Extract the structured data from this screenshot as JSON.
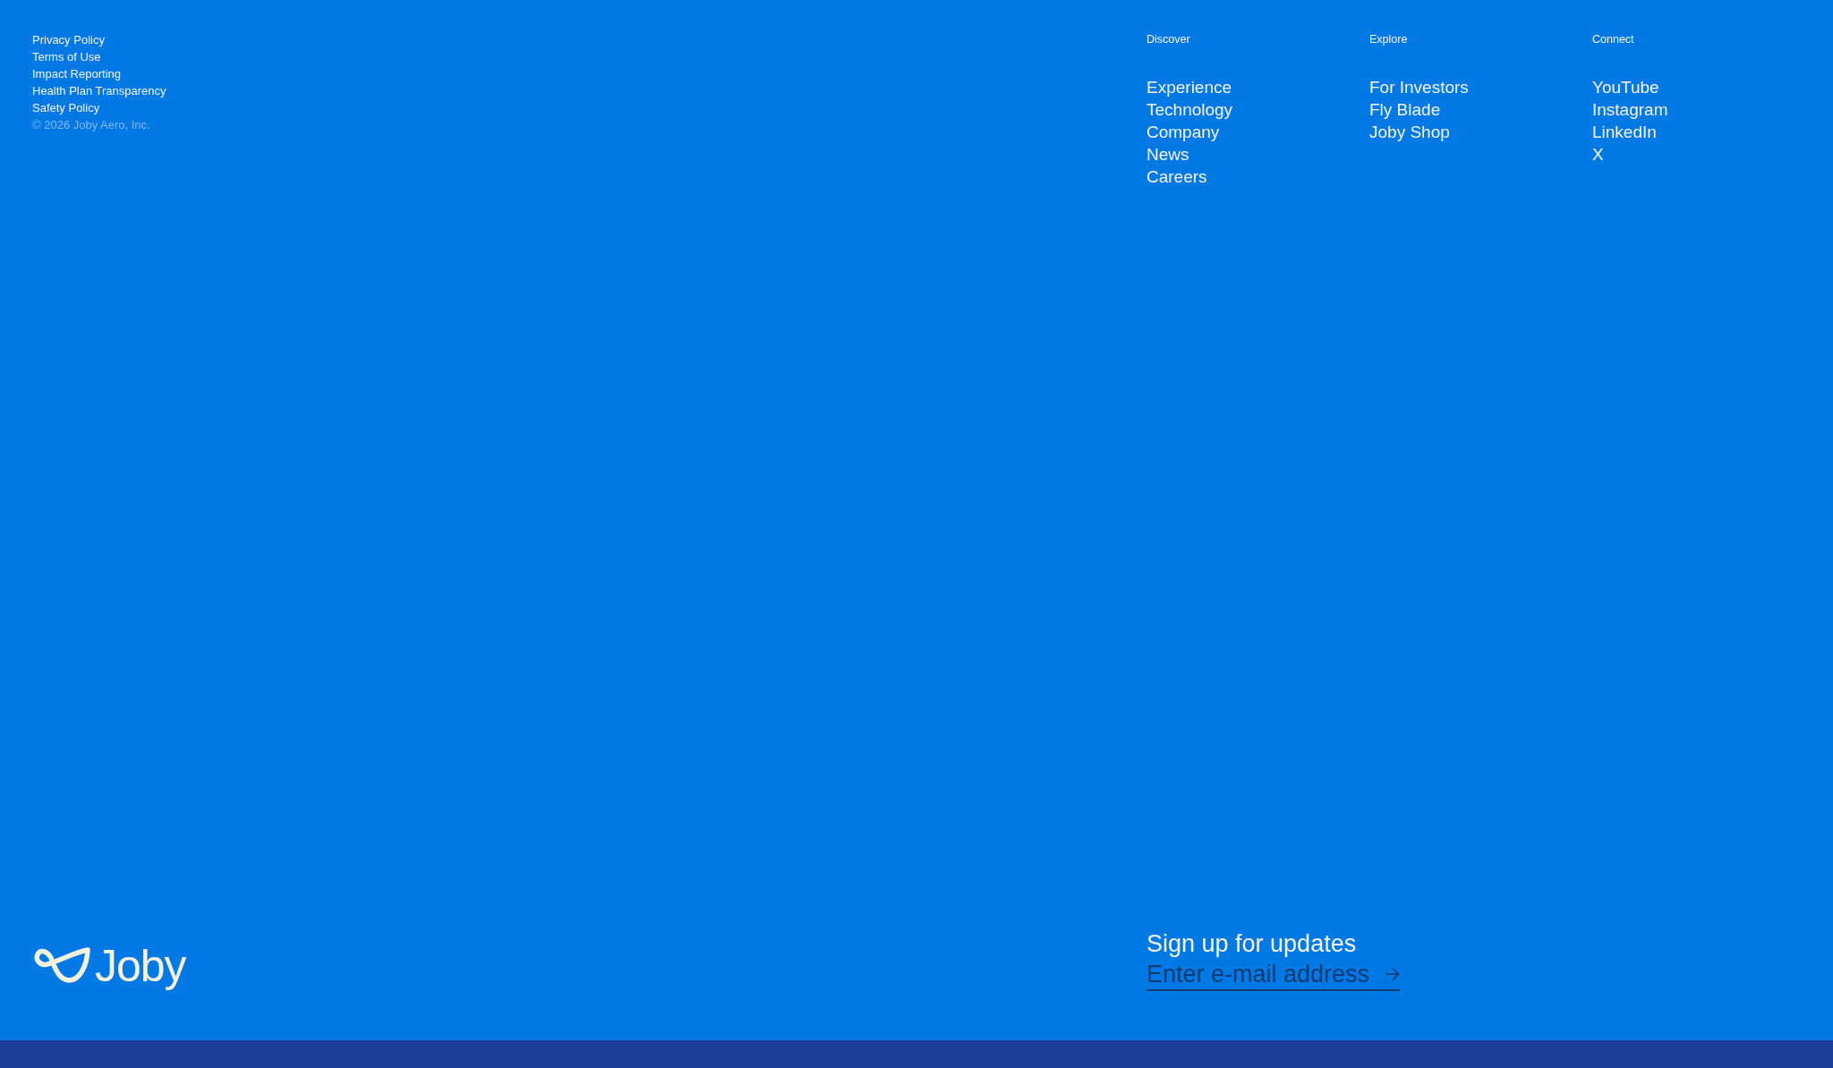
{
  "legal_links": [
    "Privacy Policy",
    "Terms of Use",
    "Impact Reporting",
    "Health Plan Transparency",
    "Safety Policy"
  ],
  "copyright": "© 2026 Joby Aero, Inc.",
  "nav_columns": [
    {
      "heading": "Discover",
      "links": [
        "Experience",
        "Technology",
        "Company",
        "News",
        "Careers"
      ]
    },
    {
      "heading": "Explore",
      "links": [
        "For Investors",
        "Fly Blade",
        "Joby Shop"
      ]
    },
    {
      "heading": "Connect",
      "links": [
        "YouTube",
        "Instagram",
        "LinkedIn",
        "X"
      ]
    }
  ],
  "logo": {
    "wordmark": "Joby"
  },
  "signup": {
    "title": "Sign up for updates",
    "email_field": {
      "placeholder": "Enter e-mail address"
    }
  }
}
